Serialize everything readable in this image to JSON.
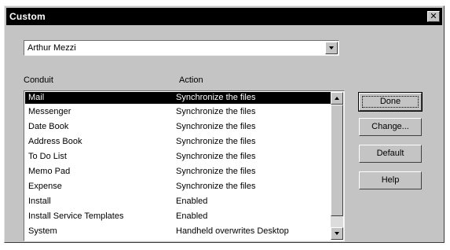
{
  "window": {
    "title": "Custom",
    "close_glyph": "✕"
  },
  "user_combo": {
    "value": "Arthur Mezzi"
  },
  "list": {
    "headers": {
      "conduit": "Conduit",
      "action": "Action"
    },
    "rows": [
      {
        "conduit": "Mail",
        "action": "Synchronize the files",
        "selected": true
      },
      {
        "conduit": "Messenger",
        "action": "Synchronize the files"
      },
      {
        "conduit": "Date Book",
        "action": "Synchronize the files"
      },
      {
        "conduit": "Address Book",
        "action": "Synchronize the files"
      },
      {
        "conduit": "To Do List",
        "action": "Synchronize the files"
      },
      {
        "conduit": "Memo Pad",
        "action": "Synchronize the files"
      },
      {
        "conduit": "Expense",
        "action": "Synchronize the files"
      },
      {
        "conduit": "Install",
        "action": "Enabled"
      },
      {
        "conduit": "Install Service Templates",
        "action": "Enabled"
      },
      {
        "conduit": "System",
        "action": "Handheld overwrites Desktop"
      }
    ]
  },
  "buttons": {
    "done": "Done",
    "change": "Change...",
    "default": "Default",
    "help": "Help"
  },
  "icons": {
    "combo": "chevron-down-icon",
    "scroll_up": "scroll-up-arrow-icon",
    "scroll_down": "scroll-down-arrow-icon",
    "close": "close-icon"
  },
  "colors": {
    "dialog_face": "#c4c4c4",
    "titlebar": "#000000",
    "selection": "#000000"
  }
}
